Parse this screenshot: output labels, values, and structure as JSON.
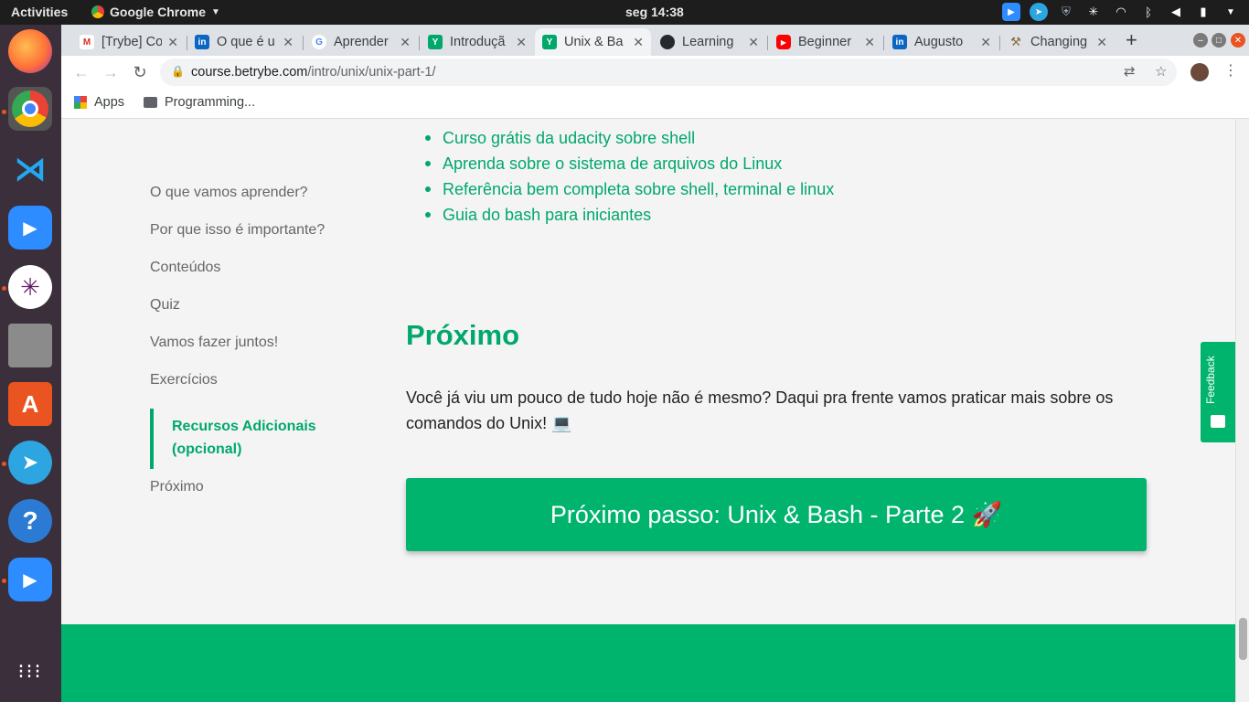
{
  "topbar": {
    "activities": "Activities",
    "app_name": "Google Chrome",
    "clock": "seg 14:38"
  },
  "tabs": [
    {
      "title": "[Trybe] Co",
      "favicon": "gmail-icon",
      "color": "#d93025"
    },
    {
      "title": "O que é u",
      "favicon": "linkedin-icon",
      "color": "#0a66c2"
    },
    {
      "title": "Aprender",
      "favicon": "google-icon",
      "color": "#4285f4"
    },
    {
      "title": "Introduçã",
      "favicon": "trybe-icon",
      "color": "#00a86b"
    },
    {
      "title": "Unix & Ba",
      "favicon": "trybe-icon",
      "color": "#00a86b"
    },
    {
      "title": "Learning",
      "favicon": "github-icon",
      "color": "#24292e"
    },
    {
      "title": "Beginner",
      "favicon": "youtube-icon",
      "color": "#ff0000"
    },
    {
      "title": "Augusto",
      "favicon": "linkedin-icon",
      "color": "#0a66c2"
    },
    {
      "title": "Changing",
      "favicon": "tools-icon",
      "color": "#8a6d3b"
    }
  ],
  "address": {
    "host": "course.betrybe.com",
    "path": "/intro/unix/unix-part-1/"
  },
  "bookmarks": {
    "apps": "Apps",
    "folder": "Programming..."
  },
  "resources": [
    "Curso grátis da udacity sobre shell",
    "Aprenda sobre o sistema de arquivos do Linux",
    "Referência bem completa sobre shell, terminal e linux",
    "Guia do bash para iniciantes"
  ],
  "sidenav": {
    "items": [
      "O que vamos aprender?",
      "Por que isso é importante?",
      "Conteúdos",
      "Quiz",
      "Vamos fazer juntos!",
      "Exercícios",
      "Recursos Adicionais (opcional)",
      "Próximo"
    ]
  },
  "section": {
    "title": "Próximo",
    "text": "Você já viu um pouco de tudo hoje não é mesmo? Daqui pra frente vamos praticar mais sobre os comandos do Unix! 💻",
    "button": "Próximo passo: Unix & Bash - Parte 2 🚀"
  },
  "feedback": "Feedback",
  "colors": {
    "accent": "#00a86b",
    "button": "#00b46e"
  }
}
